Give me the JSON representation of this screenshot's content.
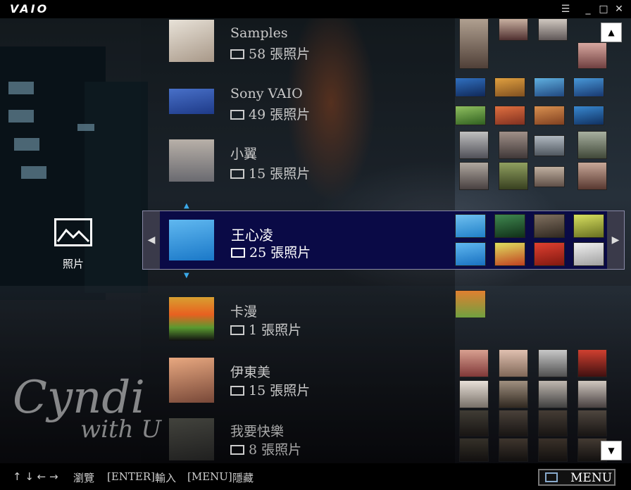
{
  "titlebar": {
    "logo": "VAIO"
  },
  "category": {
    "label": "照片"
  },
  "albums": [
    {
      "name": "Samples",
      "count": "58 張照片"
    },
    {
      "name": "Sony VAIO",
      "count": "49 張照片"
    },
    {
      "name": "小翼",
      "count": "15 張照片"
    },
    {
      "name": "王心凌",
      "count": "25 張照片"
    },
    {
      "name": "卡漫",
      "count": "1 張照片"
    },
    {
      "name": "伊東美",
      "count": "15 張照片"
    },
    {
      "name": "我要快樂",
      "count": "8 張照片"
    }
  ],
  "selected_index": 3,
  "statusbar": {
    "nav_label": "瀏覽",
    "enter_key": "[ENTER]",
    "enter_label": "輸入",
    "menu_key": "[MENU]",
    "menu_label": "隱藏"
  },
  "menu_button": {
    "label": "MENU"
  },
  "signature": {
    "line1": "Cyndi",
    "line2": "with U"
  },
  "colors": {
    "selection": "#0a0a46",
    "accent": "#3aa8e8"
  }
}
